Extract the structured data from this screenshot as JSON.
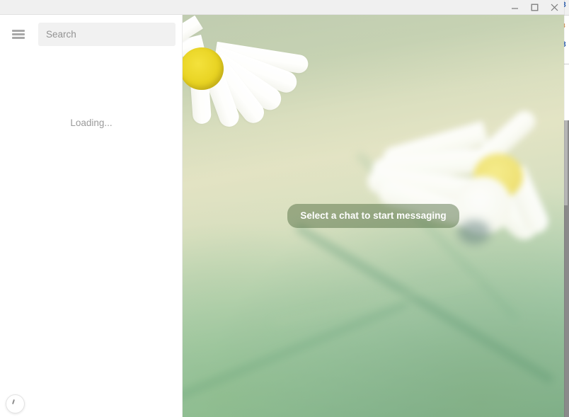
{
  "window": {
    "title": "",
    "controls": [
      {
        "name": "minimize",
        "label": "–"
      },
      {
        "name": "maximize",
        "label": "□"
      },
      {
        "name": "close",
        "label": "×"
      }
    ]
  },
  "sidebar": {
    "menu_icon": "hamburger-menu-icon",
    "search": {
      "placeholder": "Search",
      "value": ""
    },
    "status_text": "Loading...",
    "round_button_icon": "progress-spinner-icon"
  },
  "chat": {
    "empty_state_text": "Select a chat to start messaging",
    "background_image": "daisy-flowers-photo"
  },
  "background_app": {
    "glyph_1": "З",
    "glyph_2": "в",
    "glyph_3": "З"
  },
  "colors": {
    "title_bar": "#f0f0f0",
    "sidebar_bg": "#ffffff",
    "search_bg": "#f1f1f1",
    "placeholder": "#939393",
    "status_text": "#9a9a9a",
    "pill_bg": "rgba(70,100,55,0.45)",
    "pill_text": "#ffffff",
    "photo_green": "#8fc096",
    "photo_yellow": "#ead635"
  }
}
